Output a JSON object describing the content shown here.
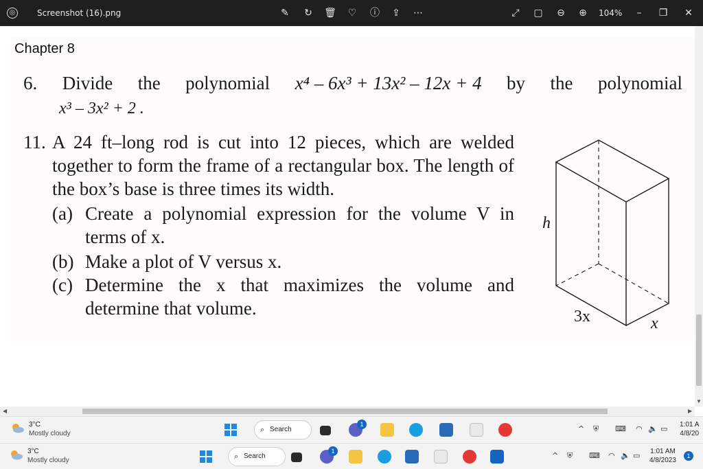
{
  "titlebar": {
    "filename": "Screenshot (16).png",
    "zoom": "104%",
    "icons": [
      "edit-image-icon",
      "rotate-icon",
      "delete-icon",
      "favorite-icon",
      "info-icon",
      "share-icon",
      "more-icon",
      "expand-icon",
      "fit-icon",
      "zoom-out-icon",
      "zoom-in-icon"
    ]
  },
  "document": {
    "chapter": "Chapter 8",
    "problem6": {
      "number": "6.",
      "words": [
        "Divide",
        "the",
        "polynomial"
      ],
      "poly1": "x⁴ – 6x³ + 13x² – 12x + 4",
      "by_words": [
        "by",
        "the",
        "polynomial"
      ],
      "poly2": "x³ – 3x² + 2 ."
    },
    "problem11": {
      "number": "11.",
      "text": "A 24 ft–long rod is cut into 12 pieces, which are welded together to form the frame of a rectangular box. The length of the box’s base is three times its width.",
      "parts": [
        {
          "label": "(a)",
          "text": "Create a polynomial expression for the volume V in terms of x."
        },
        {
          "label": "(b)",
          "text": "Make a plot of V versus x."
        },
        {
          "label": "(c)",
          "text": "Determine the x that maximizes the volume and determine that volume."
        }
      ]
    },
    "figure": {
      "h_label": "h",
      "length_label": "3x",
      "width_label": "x"
    }
  },
  "taskbar_top": {
    "temp": "3°C",
    "condition": "Mostly cloudy",
    "search": "Search",
    "time": "1:01 A",
    "date": "4/8/20",
    "badge": "1"
  },
  "taskbar_bottom": {
    "temp": "3°C",
    "condition": "Mostly cloudy",
    "search": "Search",
    "time": "1:01 AM",
    "date": "4/8/2023",
    "badge": "1",
    "notif_count": "1"
  }
}
